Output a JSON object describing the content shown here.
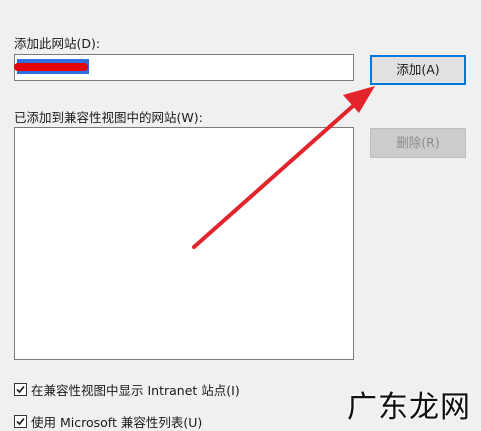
{
  "dialog": {
    "add_site_label": "添加此网站(D):",
    "add_site_value": "",
    "add_button": "添加(A)",
    "list_label": "已添加到兼容性视图中的网站(W):",
    "remove_button": "删除(R)",
    "websites": []
  },
  "options": [
    {
      "label": "在兼容性视图中显示 Intranet 站点(I)",
      "checked": true
    },
    {
      "label": "使用 Microsoft 兼容性列表(U)",
      "checked": true
    }
  ],
  "watermark": "广东龙网",
  "colors": {
    "accent": "#0078d7",
    "annotation_arrow": "#e3242b",
    "redaction": "#e60000"
  }
}
